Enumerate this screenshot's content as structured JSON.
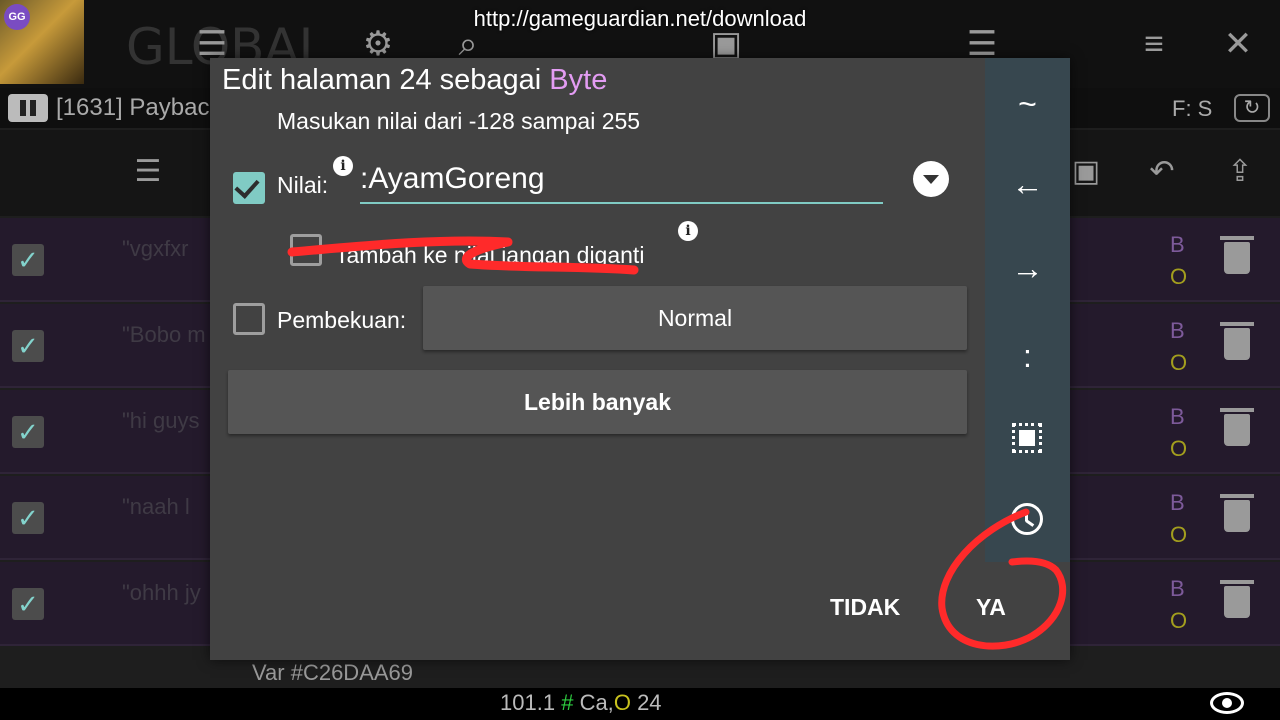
{
  "overlay_url": "http://gameguardian.net/download",
  "app": {
    "logo_text": "GG",
    "bg_title": "GLOBAL",
    "process": "[1631] Paybac",
    "fs_label": "F: S",
    "bottom_value": "101.1",
    "bottom_hash": "#",
    "bottom_ca": "Ca,",
    "bottom_o": "O",
    "bottom_count": "24",
    "var_label": "Var #C26DAA69",
    "rows": [
      {
        "text": "\"vgxfxr",
        "b": "B",
        "o": "O"
      },
      {
        "text": "\"Bobo m",
        "b": "B",
        "o": "O"
      },
      {
        "text": "\"hi guys",
        "b": "B",
        "o": "O"
      },
      {
        "text": "\"naah l",
        "b": "B",
        "o": "O"
      },
      {
        "text": "\"ohhh jy",
        "b": "B",
        "o": "O"
      }
    ]
  },
  "dialog": {
    "title_prefix": "Edit halaman 24 sebagai ",
    "title_type": "Byte",
    "subtitle": "Masukan nilai dari -128 sampai 255",
    "value_label": "Nilai:",
    "value": ":AyamGoreng",
    "add_label": "Tambah ke nilai jangan diganti",
    "freeze_label": "Pembekuan:",
    "freeze_mode": "Normal",
    "more_label": "Lebih banyak",
    "no_label": "TIDAK",
    "yes_label": "YA",
    "side_buttons": [
      "~",
      "←",
      "→",
      ":"
    ]
  },
  "colors": {
    "dialog_bg": "#424242",
    "accent": "#80cbc4",
    "type_color": "#e39cf3",
    "side_panel": "#37474f",
    "annotation": "#ff2a2a"
  },
  "icons": {
    "info": "i"
  }
}
